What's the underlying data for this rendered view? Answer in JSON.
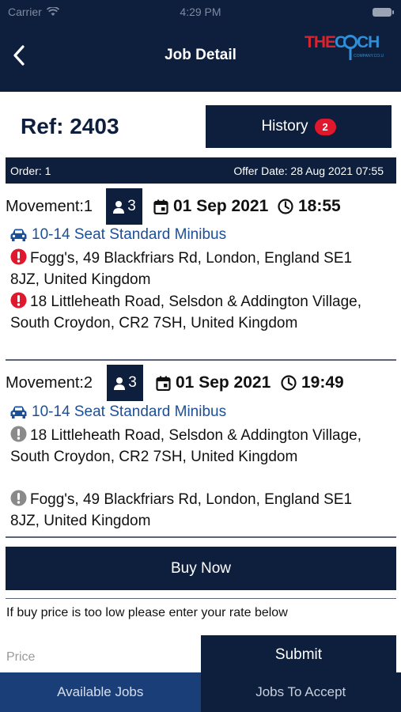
{
  "status_bar": {
    "carrier": "Carrier",
    "time": "4:29 PM"
  },
  "header": {
    "title": "Job Detail",
    "logo_text": "THECOACH",
    "logo_sub": "COMPANY.CO.UK"
  },
  "job": {
    "ref": "Ref: 2403",
    "history_label": "History",
    "history_count": "2",
    "order": "Order: 1",
    "offer_date": "Offer Date: 28 Aug 2021 07:55"
  },
  "movements": [
    {
      "label": "Movement:1",
      "passengers": "3",
      "date": "01 Sep 2021",
      "time": "18:55",
      "vehicle": "10-14 Seat Standard Minibus",
      "pickup": "Fogg's, 49 Blackfriars Rd, London, England SE1 8JZ, United Kingdom",
      "dropoff": "18 Littleheath Road, Selsdon & Addington Village, South Croydon, CR2 7SH, United Kingdom"
    },
    {
      "label": "Movement:2",
      "passengers": "3",
      "date": "01 Sep 2021",
      "time": "19:49",
      "vehicle": "10-14 Seat Standard Minibus",
      "pickup": "18 Littleheath Road, Selsdon & Addington Village, South Croydon, CR2 7SH, United Kingdom",
      "dropoff": "Fogg's, 49 Blackfriars Rd, London, England SE1 8JZ, United Kingdom"
    }
  ],
  "actions": {
    "buy_now": "Buy Now",
    "hint": "If buy price is too low please enter your rate below",
    "price_placeholder": "Price",
    "submit": "Submit"
  },
  "tabs": [
    {
      "label": "Available Jobs",
      "active": true
    },
    {
      "label": "Jobs To Accept",
      "active": false
    }
  ],
  "colors": {
    "navy": "#0d1f3c",
    "tab_active": "#1a3e77",
    "alert_red": "#e0182d",
    "link_blue": "#1d4f95",
    "muted_grey": "#8a8a8a"
  }
}
